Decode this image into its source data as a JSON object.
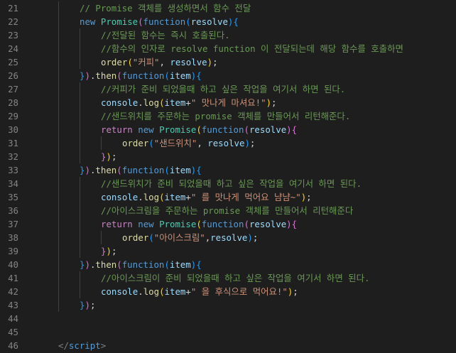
{
  "editor": {
    "colors": {
      "background": "#1e1e1e",
      "line_number": "#858585",
      "comment": "#6a9955",
      "keyword": "#569cd6",
      "control": "#c586c0",
      "class": "#4ec9b0",
      "function": "#dcdcaa",
      "parameter": "#9cdcfe",
      "string": "#ce9178",
      "text": "#d4d4d4",
      "bracket_1": "#ffd700",
      "bracket_2": "#da70d6",
      "bracket_3": "#179fff"
    },
    "lines": [
      {
        "number": "21",
        "indent": 4,
        "tokens": [
          {
            "text": "// Promise 객체를 생성하면서 함수 전달",
            "type": "comment"
          }
        ]
      },
      {
        "number": "22",
        "indent": 4,
        "tokens": [
          {
            "text": "new",
            "type": "keyword"
          },
          {
            "text": " ",
            "type": "punc"
          },
          {
            "text": "Promise",
            "type": "class"
          },
          {
            "text": "(",
            "type": "br2"
          },
          {
            "text": "function",
            "type": "keyword"
          },
          {
            "text": "(",
            "type": "br3"
          },
          {
            "text": "resolve",
            "type": "param"
          },
          {
            "text": ")",
            "type": "br3"
          },
          {
            "text": "{",
            "type": "br3"
          }
        ]
      },
      {
        "number": "23",
        "indent": 8,
        "tokens": [
          {
            "text": "//전달된 함수는 즉시 호출된다.",
            "type": "comment"
          }
        ]
      },
      {
        "number": "24",
        "indent": 8,
        "tokens": [
          {
            "text": "//함수의 인자로 resolve function 이 전달되는데 해당 함수를 호출하면",
            "type": "comment"
          }
        ]
      },
      {
        "number": "25",
        "indent": 8,
        "tokens": [
          {
            "text": "order",
            "type": "func"
          },
          {
            "text": "(",
            "type": "br1"
          },
          {
            "text": "\"커피\"",
            "type": "string"
          },
          {
            "text": ", ",
            "type": "punc"
          },
          {
            "text": "resolve",
            "type": "param"
          },
          {
            "text": ")",
            "type": "br1"
          },
          {
            "text": ";",
            "type": "punc"
          }
        ]
      },
      {
        "number": "26",
        "indent": 4,
        "tokens": [
          {
            "text": "}",
            "type": "br3"
          },
          {
            "text": ")",
            "type": "br2"
          },
          {
            "text": ".",
            "type": "punc"
          },
          {
            "text": "then",
            "type": "func"
          },
          {
            "text": "(",
            "type": "br2"
          },
          {
            "text": "function",
            "type": "keyword"
          },
          {
            "text": "(",
            "type": "br3"
          },
          {
            "text": "item",
            "type": "param"
          },
          {
            "text": ")",
            "type": "br3"
          },
          {
            "text": "{",
            "type": "br3"
          }
        ]
      },
      {
        "number": "27",
        "indent": 8,
        "tokens": [
          {
            "text": "//커피가 준비 되었을때 하고 싶은 작업을 여기서 하면 된다.",
            "type": "comment"
          }
        ]
      },
      {
        "number": "28",
        "indent": 8,
        "tokens": [
          {
            "text": "console",
            "type": "param"
          },
          {
            "text": ".",
            "type": "punc"
          },
          {
            "text": "log",
            "type": "func"
          },
          {
            "text": "(",
            "type": "br1"
          },
          {
            "text": "item",
            "type": "param"
          },
          {
            "text": "+",
            "type": "punc"
          },
          {
            "text": "\" 맛나게 마셔요!\"",
            "type": "string"
          },
          {
            "text": ")",
            "type": "br1"
          },
          {
            "text": ";",
            "type": "punc"
          }
        ]
      },
      {
        "number": "29",
        "indent": 8,
        "tokens": [
          {
            "text": "//샌드위치를 주문하는 promise 객체를 만들어서 리턴해준다.",
            "type": "comment"
          }
        ]
      },
      {
        "number": "30",
        "indent": 8,
        "tokens": [
          {
            "text": "return",
            "type": "control"
          },
          {
            "text": " ",
            "type": "punc"
          },
          {
            "text": "new",
            "type": "keyword"
          },
          {
            "text": " ",
            "type": "punc"
          },
          {
            "text": "Promise",
            "type": "class"
          },
          {
            "text": "(",
            "type": "br1"
          },
          {
            "text": "function",
            "type": "keyword"
          },
          {
            "text": "(",
            "type": "br2"
          },
          {
            "text": "resolve",
            "type": "param"
          },
          {
            "text": ")",
            "type": "br2"
          },
          {
            "text": "{",
            "type": "br2"
          }
        ]
      },
      {
        "number": "31",
        "indent": 12,
        "tokens": [
          {
            "text": "order",
            "type": "func"
          },
          {
            "text": "(",
            "type": "br3"
          },
          {
            "text": "\"샌드위치\"",
            "type": "string"
          },
          {
            "text": ", ",
            "type": "punc"
          },
          {
            "text": "resolve",
            "type": "param"
          },
          {
            "text": ")",
            "type": "br3"
          },
          {
            "text": ";",
            "type": "punc"
          }
        ]
      },
      {
        "number": "32",
        "indent": 8,
        "tokens": [
          {
            "text": "}",
            "type": "br2"
          },
          {
            "text": ")",
            "type": "br1"
          },
          {
            "text": ";",
            "type": "punc"
          }
        ]
      },
      {
        "number": "33",
        "indent": 4,
        "tokens": [
          {
            "text": "}",
            "type": "br3"
          },
          {
            "text": ")",
            "type": "br2"
          },
          {
            "text": ".",
            "type": "punc"
          },
          {
            "text": "then",
            "type": "func"
          },
          {
            "text": "(",
            "type": "br2"
          },
          {
            "text": "function",
            "type": "keyword"
          },
          {
            "text": "(",
            "type": "br3"
          },
          {
            "text": "item",
            "type": "param"
          },
          {
            "text": ")",
            "type": "br3"
          },
          {
            "text": "{",
            "type": "br3"
          }
        ]
      },
      {
        "number": "34",
        "indent": 8,
        "tokens": [
          {
            "text": "//샌드위치가 준비 되었을때 하고 싶은 작업을 여기서 하면 된다.",
            "type": "comment"
          }
        ]
      },
      {
        "number": "35",
        "indent": 8,
        "tokens": [
          {
            "text": "console",
            "type": "param"
          },
          {
            "text": ".",
            "type": "punc"
          },
          {
            "text": "log",
            "type": "func"
          },
          {
            "text": "(",
            "type": "br1"
          },
          {
            "text": "item",
            "type": "param"
          },
          {
            "text": "+",
            "type": "punc"
          },
          {
            "text": "\" 를 맛나게 먹어요 냠냠~\"",
            "type": "string"
          },
          {
            "text": ")",
            "type": "br1"
          },
          {
            "text": ";",
            "type": "punc"
          }
        ]
      },
      {
        "number": "36",
        "indent": 8,
        "tokens": [
          {
            "text": "//아이스크림을 주문하는 promise 객체를 만들어서 리턴해준다",
            "type": "comment"
          }
        ]
      },
      {
        "number": "37",
        "indent": 8,
        "tokens": [
          {
            "text": "return",
            "type": "control"
          },
          {
            "text": " ",
            "type": "punc"
          },
          {
            "text": "new",
            "type": "keyword"
          },
          {
            "text": " ",
            "type": "punc"
          },
          {
            "text": "Promise",
            "type": "class"
          },
          {
            "text": "(",
            "type": "br1"
          },
          {
            "text": "function",
            "type": "keyword"
          },
          {
            "text": "(",
            "type": "br2"
          },
          {
            "text": "resolve",
            "type": "param"
          },
          {
            "text": ")",
            "type": "br2"
          },
          {
            "text": "{",
            "type": "br2"
          }
        ]
      },
      {
        "number": "38",
        "indent": 12,
        "tokens": [
          {
            "text": "order",
            "type": "func"
          },
          {
            "text": "(",
            "type": "br3"
          },
          {
            "text": "\"아이스크림\"",
            "type": "string"
          },
          {
            "text": ",",
            "type": "punc"
          },
          {
            "text": "resolve",
            "type": "param"
          },
          {
            "text": ")",
            "type": "br3"
          },
          {
            "text": ";",
            "type": "punc"
          }
        ]
      },
      {
        "number": "39",
        "indent": 8,
        "tokens": [
          {
            "text": "}",
            "type": "br2"
          },
          {
            "text": ")",
            "type": "br1"
          },
          {
            "text": ";",
            "type": "punc"
          }
        ]
      },
      {
        "number": "40",
        "indent": 4,
        "tokens": [
          {
            "text": "}",
            "type": "br3"
          },
          {
            "text": ")",
            "type": "br2"
          },
          {
            "text": ".",
            "type": "punc"
          },
          {
            "text": "then",
            "type": "func"
          },
          {
            "text": "(",
            "type": "br2"
          },
          {
            "text": "function",
            "type": "keyword"
          },
          {
            "text": "(",
            "type": "br3"
          },
          {
            "text": "item",
            "type": "param"
          },
          {
            "text": ")",
            "type": "br3"
          },
          {
            "text": "{",
            "type": "br3"
          }
        ]
      },
      {
        "number": "41",
        "indent": 8,
        "tokens": [
          {
            "text": "//아이스크림이 준비 되었을때 하고 싶은 작업을 여기서 하면 된다.",
            "type": "comment"
          }
        ]
      },
      {
        "number": "42",
        "indent": 8,
        "tokens": [
          {
            "text": "console",
            "type": "param"
          },
          {
            "text": ".",
            "type": "punc"
          },
          {
            "text": "log",
            "type": "func"
          },
          {
            "text": "(",
            "type": "br1"
          },
          {
            "text": "item",
            "type": "param"
          },
          {
            "text": "+",
            "type": "punc"
          },
          {
            "text": "\" 을 후식으로 먹어요!\"",
            "type": "string"
          },
          {
            "text": ")",
            "type": "br1"
          },
          {
            "text": ";",
            "type": "punc"
          }
        ]
      },
      {
        "number": "43",
        "indent": 4,
        "tokens": [
          {
            "text": "}",
            "type": "br3"
          },
          {
            "text": ")",
            "type": "br2"
          },
          {
            "text": ";",
            "type": "punc"
          }
        ]
      },
      {
        "number": "44",
        "indent": 0,
        "tokens": []
      },
      {
        "number": "45",
        "indent": 0,
        "tokens": []
      },
      {
        "number": "46",
        "indent": 0,
        "tokens": [
          {
            "text": "</",
            "type": "tag"
          },
          {
            "text": "script",
            "type": "tagname"
          },
          {
            "text": ">",
            "type": "tag"
          }
        ]
      }
    ]
  }
}
